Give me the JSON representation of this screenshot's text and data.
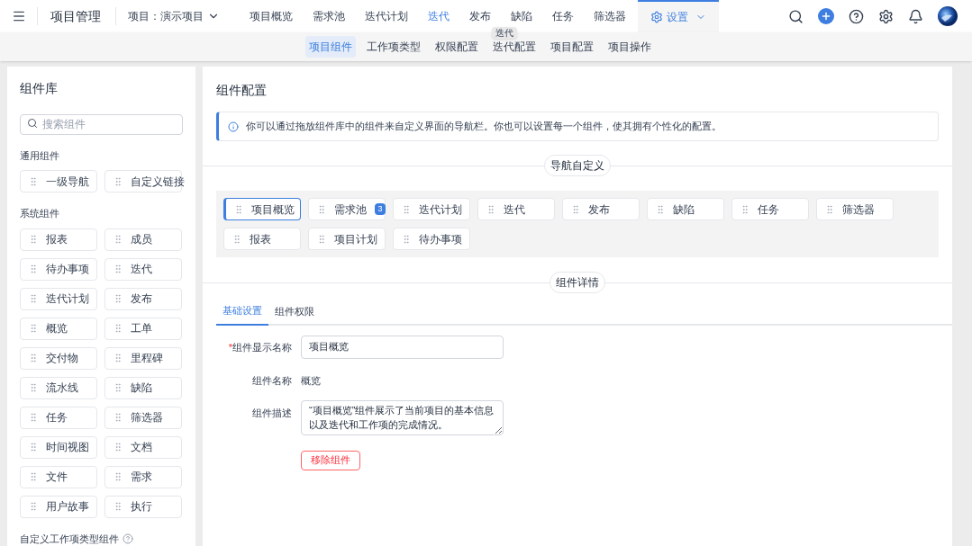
{
  "app": {
    "title": "项目管理",
    "project_label": "项目：",
    "project_name": "演示项目"
  },
  "nav": [
    {
      "label": "项目概览",
      "selected": false,
      "hovered": false
    },
    {
      "label": "需求池",
      "selected": false,
      "hovered": false
    },
    {
      "label": "迭代计划",
      "selected": false,
      "hovered": false
    },
    {
      "label": "迭代",
      "selected": false,
      "hovered": true
    },
    {
      "label": "发布",
      "selected": false,
      "hovered": false
    },
    {
      "label": "缺陷",
      "selected": false,
      "hovered": false
    },
    {
      "label": "任务",
      "selected": false,
      "hovered": false
    },
    {
      "label": "筛选器",
      "selected": false,
      "hovered": false
    }
  ],
  "settings_tab": {
    "label": "设置",
    "selected": true
  },
  "tooltip": "迭代",
  "subtabs": [
    {
      "label": "项目组件",
      "selected": true
    },
    {
      "label": "工作项类型",
      "selected": false
    },
    {
      "label": "权限配置",
      "selected": false
    },
    {
      "label": "迭代配置",
      "selected": false
    },
    {
      "label": "项目配置",
      "selected": false
    },
    {
      "label": "项目操作",
      "selected": false
    }
  ],
  "library": {
    "title": "组件库",
    "search_placeholder": "搜索组件",
    "groups": [
      {
        "title": "通用组件",
        "items": [
          "一级导航",
          "自定义链接"
        ]
      },
      {
        "title": "系统组件",
        "items": [
          "报表",
          "成员",
          "待办事项",
          "迭代",
          "迭代计划",
          "发布",
          "概览",
          "工单",
          "交付物",
          "里程碑",
          "流水线",
          "缺陷",
          "任务",
          "筛选器",
          "时间视图",
          "文档",
          "文件",
          "需求",
          "用户故事",
          "执行"
        ]
      }
    ],
    "custom_group_title": "自定义工作项类型组件"
  },
  "config": {
    "title": "组件配置",
    "info": "你可以通过拖放组件库中的组件来自定义界面的导航栏。你也可以设置每一个组件，使其拥有个性化的配置。",
    "nav_section_title": "导航自定义",
    "nav_items": [
      {
        "label": "项目概览",
        "selected": true
      },
      {
        "label": "需求池",
        "selected": false,
        "badge": "3"
      },
      {
        "label": "迭代计划",
        "selected": false
      },
      {
        "label": "迭代",
        "selected": false
      },
      {
        "label": "发布",
        "selected": false
      },
      {
        "label": "缺陷",
        "selected": false
      },
      {
        "label": "任务",
        "selected": false
      },
      {
        "label": "筛选器",
        "selected": false
      },
      {
        "label": "报表",
        "selected": false
      },
      {
        "label": "项目计划",
        "selected": false
      },
      {
        "label": "待办事项",
        "selected": false
      }
    ],
    "detail_section_title": "组件详情",
    "detail_tabs": [
      {
        "label": "基础设置",
        "selected": true
      },
      {
        "label": "组件权限",
        "selected": false
      }
    ],
    "form": [
      {
        "kind": "input",
        "label": "组件显示名称",
        "required_mark": "*",
        "value": "项目概览"
      },
      {
        "kind": "text",
        "label": "组件名称",
        "value": "概览"
      },
      {
        "kind": "textarea",
        "label": "组件描述",
        "value": "“项目概览”组件展示了当前项目的基本信息以及迭代和工作项的完成情况。"
      }
    ],
    "remove_button": "移除组件"
  }
}
